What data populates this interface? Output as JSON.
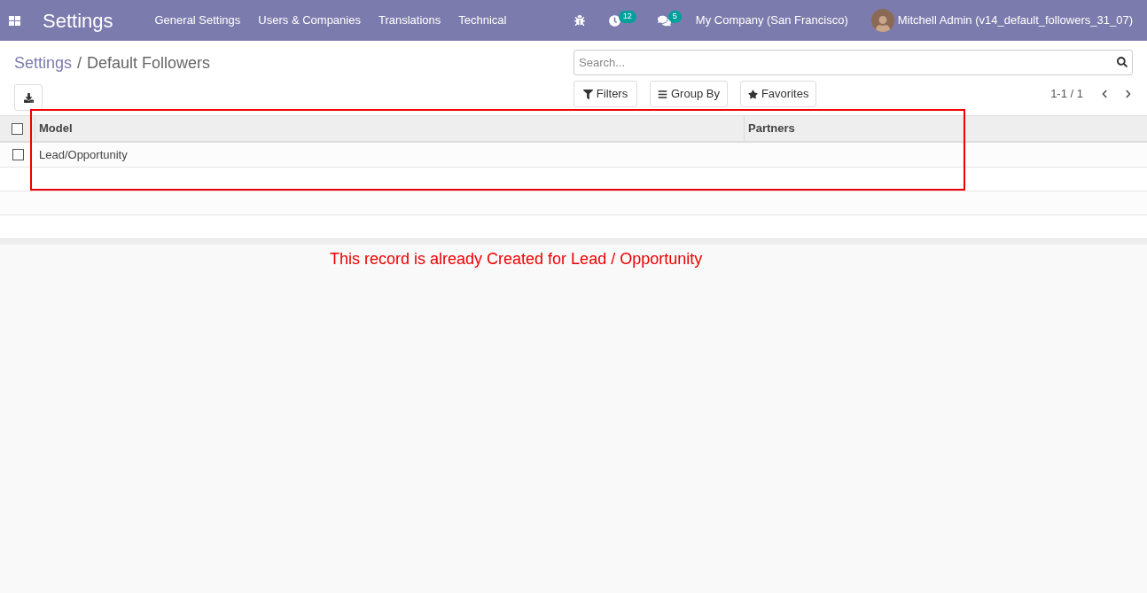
{
  "navbar": {
    "app_title": "Settings",
    "menu": [
      "General Settings",
      "Users & Companies",
      "Translations",
      "Technical"
    ],
    "activity_count": "12",
    "message_count": "5",
    "company": "My Company (San Francisco)",
    "user": "Mitchell Admin (v14_default_followers_31_07)"
  },
  "breadcrumb": {
    "parent": "Settings",
    "separator": "/",
    "current": "Default Followers"
  },
  "search": {
    "placeholder": "Search..."
  },
  "filters": [
    "Filters",
    "Group By",
    "Favorites"
  ],
  "pager": "1-1 / 1",
  "table": {
    "select_all_checked": false,
    "columns": [
      "Model",
      "Partners"
    ],
    "rows": [
      {
        "checked": false,
        "cells": [
          "Lead/Opportunity",
          ""
        ]
      }
    ]
  },
  "annotation": {
    "note": "This record is already Created for Lead / Opportunity"
  }
}
